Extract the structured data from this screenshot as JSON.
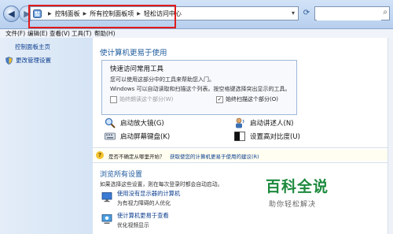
{
  "breadcrumb": [
    "控制面板",
    "所有控制面板项",
    "轻松访问中心"
  ],
  "search": {
    "placeholder": ""
  },
  "menu": [
    "文件(F)",
    "编辑(E)",
    "查看(V)",
    "工具(T)",
    "帮助(H)"
  ],
  "sidebar": {
    "home": "控制面板主页",
    "link": "更改管理设置"
  },
  "main": {
    "title": "使计算机更易于使用",
    "quick": {
      "title": "快速访问常用工具",
      "line1": "您可以使用这部分中的工具来帮助您入门。",
      "line2": "Windows 可以自动读取和扫描这个列表。按空格键选择突出显示的工具。",
      "cb1": "始终朗读这个部分(W)",
      "cb2": "始终扫描这个部分(O)",
      "cb2_checked": true
    },
    "tools": [
      {
        "label": "启动放大镜(G)",
        "icon": "magnifier-icon"
      },
      {
        "label": "启动讲述人(N)",
        "icon": "narrator-icon"
      },
      {
        "label": "启动屏幕键盘(K)",
        "icon": "keyboard-icon"
      },
      {
        "label": "设置高对比度(U)",
        "icon": "contrast-icon"
      }
    ],
    "tip": {
      "question": "是否不确定从哪里开始？",
      "link": "获取使您的计算机更易于使用的建议(R)"
    },
    "section": {
      "title": "浏览所有设置",
      "desc": "如果选择这些设置，则在每次登录时都会自动启动。"
    },
    "items": [
      {
        "title": "使用没有显示器的计算机",
        "desc": "为有视力障碍的人优化",
        "icon": "monitor-icon"
      },
      {
        "title": "使计算机更易于查看",
        "desc": "优化视频显示",
        "icon": "display-icon"
      }
    ]
  },
  "watermark": {
    "main": "百科全说",
    "sub": "助你轻松解决"
  },
  "colors": {
    "link": "#0b3d8f",
    "title": "#1e5b9d",
    "highlight": "#e01c1c",
    "watermark": "#1c8a3d"
  }
}
